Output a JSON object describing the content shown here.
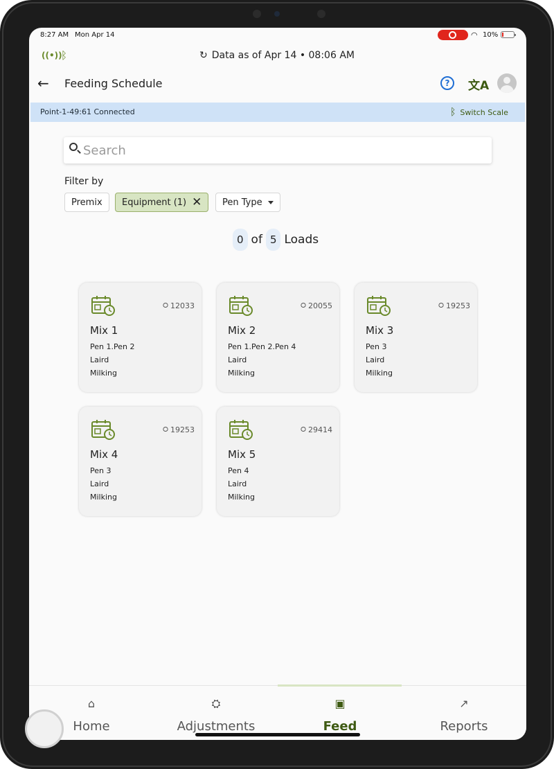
{
  "status_bar": {
    "time": "8:27 AM",
    "date": "Mon Apr 14",
    "battery": "10%"
  },
  "info_row": {
    "data_as_of": "Data as of Apr 14 • 08:06 AM"
  },
  "app_bar": {
    "title": "Feeding Schedule"
  },
  "banner": {
    "connection": "Point-1-49:61 Connected",
    "switch_scale": "Switch Scale"
  },
  "search": {
    "placeholder": "Search",
    "value": ""
  },
  "filters": {
    "label": "Filter by",
    "chips": [
      "Premix",
      "Equipment (1)",
      "Pen Type"
    ]
  },
  "loads": {
    "done": "0",
    "of_word": "of",
    "total": "5",
    "loads_word": "Loads"
  },
  "cards": [
    {
      "weight": "12033",
      "name": "Mix 1",
      "pens": "Pen 1.Pen 2",
      "location": "Laird",
      "type": "Milking"
    },
    {
      "weight": "20055",
      "name": "Mix 2",
      "pens": "Pen 1.Pen 2.Pen 4",
      "location": "Laird",
      "type": "Milking"
    },
    {
      "weight": "19253",
      "name": "Mix 3",
      "pens": "Pen 3",
      "location": "Laird",
      "type": "Milking"
    },
    {
      "weight": "19253",
      "name": "Mix 4",
      "pens": "Pen 3",
      "location": "Laird",
      "type": "Milking"
    },
    {
      "weight": "29414",
      "name": "Mix 5",
      "pens": "Pen 4",
      "location": "Laird",
      "type": "Milking"
    }
  ],
  "bottom_nav": [
    {
      "label": "Home",
      "icon": "home-icon"
    },
    {
      "label": "Adjustments",
      "icon": "adjustments-icon"
    },
    {
      "label": "Feed",
      "icon": "feed-icon",
      "active": true
    },
    {
      "label": "Reports",
      "icon": "reports-icon"
    }
  ],
  "colors": {
    "accent": "#3e5a12",
    "chip_active": "#d8e5c3",
    "banner": "#cfe2f7",
    "help": "#1f6ed4"
  }
}
